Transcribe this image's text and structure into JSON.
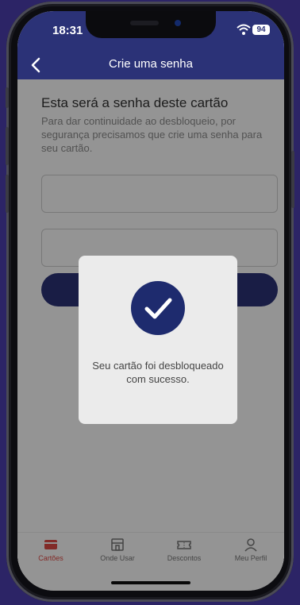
{
  "status_bar": {
    "time": "18:31",
    "battery": "94"
  },
  "nav": {
    "title": "Crie uma senha",
    "back_icon": "chevron-left-icon"
  },
  "content": {
    "headline": "Esta será a senha deste cartão",
    "description": "Para dar continuidade ao desbloqueio, por segurança precisamos que crie uma senha para seu cartão.",
    "password_value": "",
    "confirm_password_value": "",
    "submit_label": ""
  },
  "dialog": {
    "icon": "check-icon",
    "message": "Seu cartão foi desbloqueado com sucesso."
  },
  "tab_bar": {
    "items": [
      {
        "label": "Cartões",
        "icon": "card-icon",
        "active": true
      },
      {
        "label": "Onde Usar",
        "icon": "store-icon",
        "active": false
      },
      {
        "label": "Descontos",
        "icon": "ticket-icon",
        "active": false
      },
      {
        "label": "Meu Perfil",
        "icon": "user-icon",
        "active": false
      }
    ]
  },
  "colors": {
    "brand": "#2b3277",
    "active_tab": "#e04a45",
    "background": "#2c2466"
  }
}
